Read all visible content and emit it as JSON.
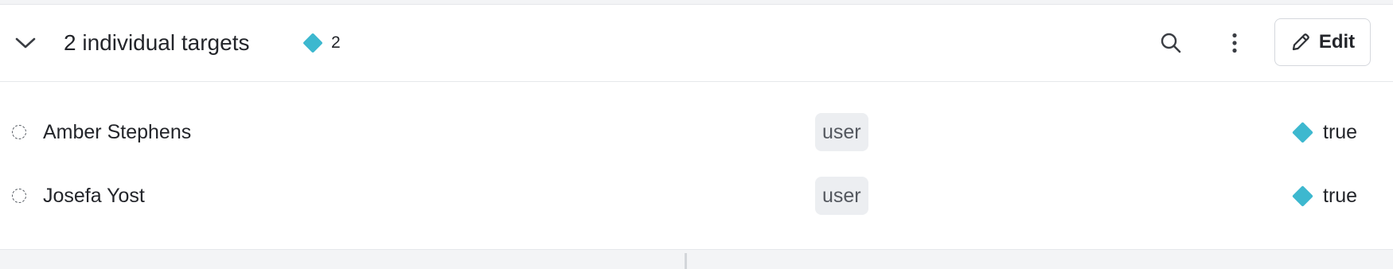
{
  "header": {
    "title": "2 individual targets",
    "variation_count": "2",
    "edit_label": "Edit"
  },
  "icons": {
    "collapse": "chevron-down-icon",
    "search": "search-icon",
    "more": "more-vertical-icon",
    "edit": "pencil-icon",
    "variation": "diamond-icon",
    "status": "dashed-circle-icon"
  },
  "colors": {
    "variation_accent": "#3db8cf",
    "badge_bg": "#eceef1"
  },
  "rows": [
    {
      "name": "Amber Stephens",
      "kind": "user",
      "value": "true"
    },
    {
      "name": "Josefa Yost",
      "kind": "user",
      "value": "true"
    }
  ]
}
